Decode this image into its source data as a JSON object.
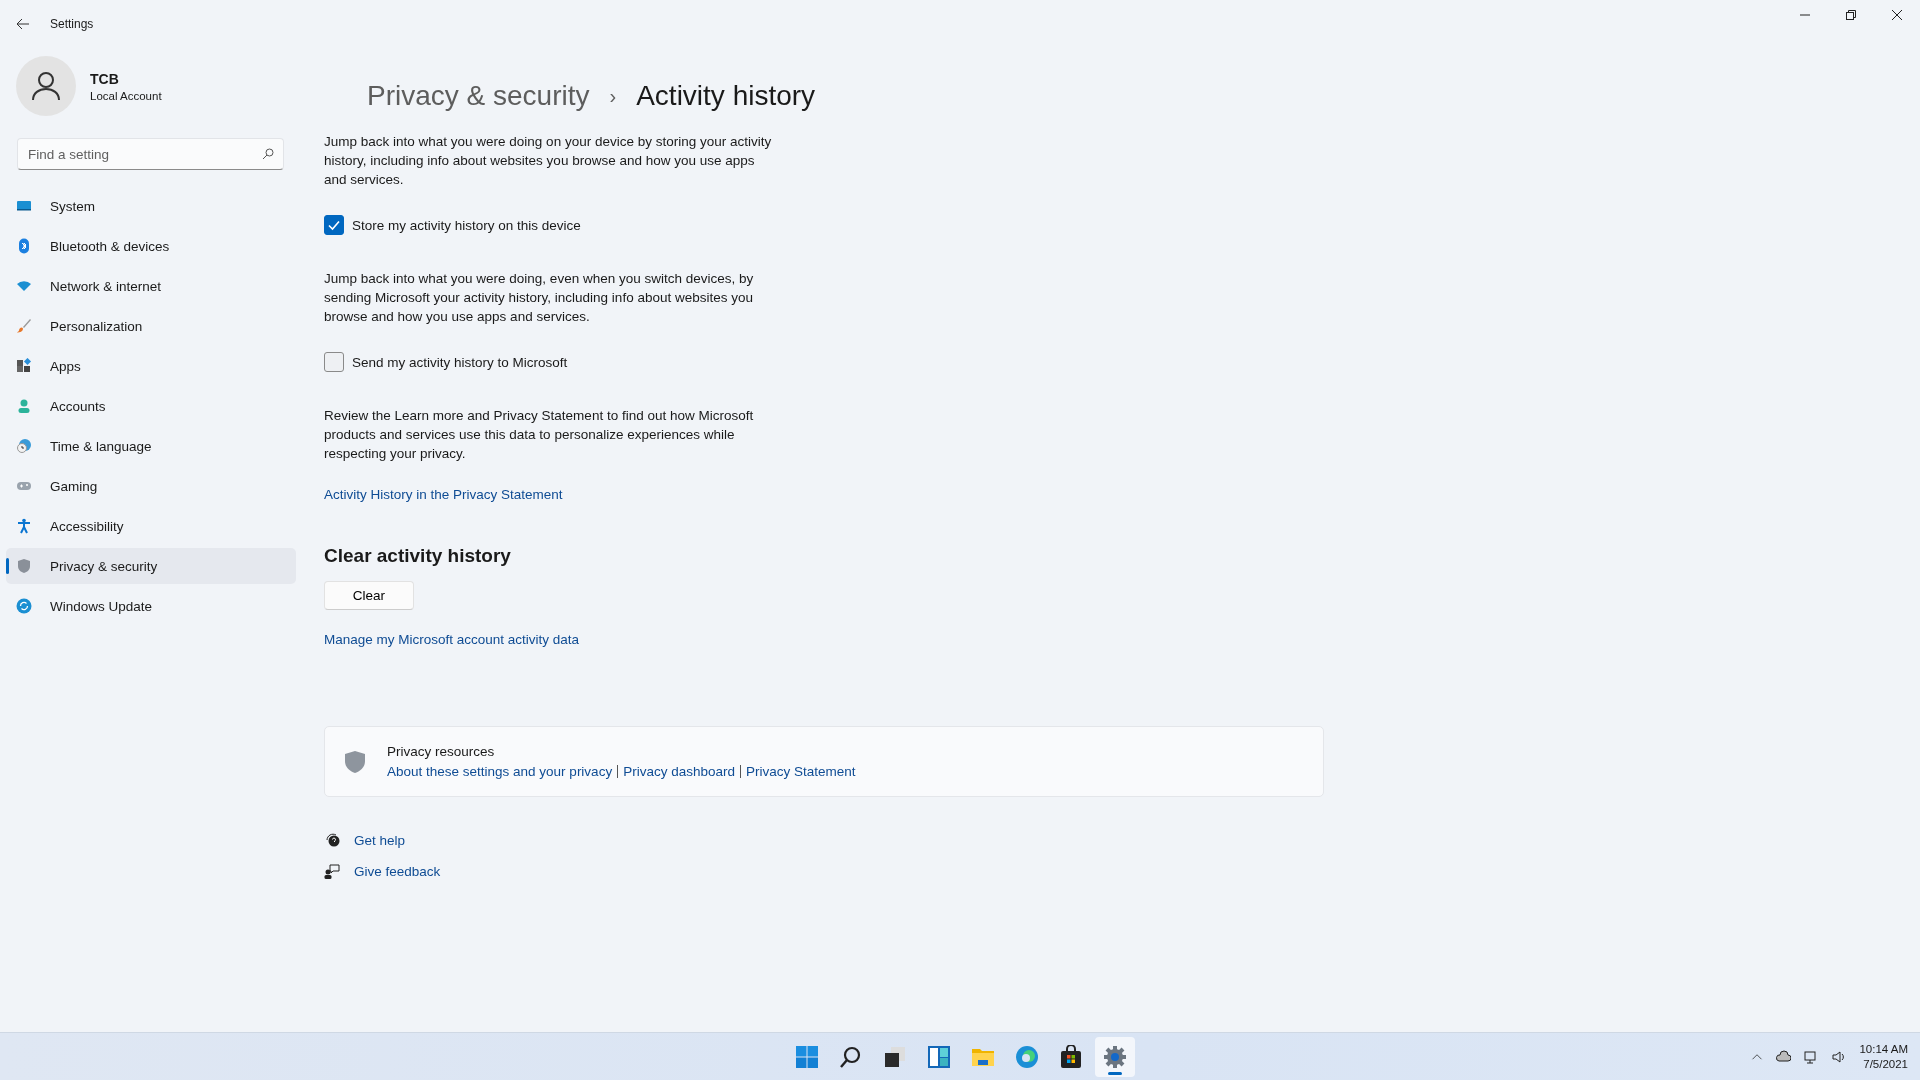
{
  "window": {
    "title": "Settings"
  },
  "account": {
    "name": "TCB",
    "type": "Local Account"
  },
  "search": {
    "placeholder": "Find a setting"
  },
  "nav": [
    {
      "label": "System",
      "selected": false
    },
    {
      "label": "Bluetooth & devices",
      "selected": false
    },
    {
      "label": "Network & internet",
      "selected": false
    },
    {
      "label": "Personalization",
      "selected": false
    },
    {
      "label": "Apps",
      "selected": false
    },
    {
      "label": "Accounts",
      "selected": false
    },
    {
      "label": "Time & language",
      "selected": false
    },
    {
      "label": "Gaming",
      "selected": false
    },
    {
      "label": "Accessibility",
      "selected": false
    },
    {
      "label": "Privacy & security",
      "selected": true
    },
    {
      "label": "Windows Update",
      "selected": false
    }
  ],
  "breadcrumb": {
    "parent": "Privacy & security",
    "separator": "›",
    "current": "Activity history"
  },
  "sections": [
    {
      "text": "Jump back into what you were doing on your device by storing your activity history, including info about websites you browse and how you use apps and services.",
      "checkbox": {
        "label": "Store my activity history on this device",
        "checked": true
      }
    },
    {
      "text": "Jump back into what you were doing, even when you switch devices, by sending Microsoft your activity history, including info about websites you browse and how you use apps and services.",
      "checkbox": {
        "label": "Send my activity history to Microsoft",
        "checked": false
      }
    }
  ],
  "review_text": "Review the Learn more and Privacy Statement to find out how Microsoft products and services use this data to personalize experiences while respecting your privacy.",
  "privacy_link": "Activity History in the Privacy Statement",
  "clear": {
    "heading": "Clear activity history",
    "button": "Clear",
    "link": "Manage my Microsoft account activity data"
  },
  "resources": {
    "title": "Privacy resources",
    "links": [
      "About these settings and your privacy",
      "Privacy dashboard",
      "Privacy Statement"
    ]
  },
  "help_links": [
    "Get help",
    "Give feedback"
  ],
  "taskbar": {
    "apps": [
      {
        "kind": "start",
        "selected": false
      },
      {
        "kind": "search",
        "selected": false
      },
      {
        "kind": "taskview",
        "selected": false
      },
      {
        "kind": "widgets",
        "selected": false
      },
      {
        "kind": "explorer",
        "selected": false
      },
      {
        "kind": "browser",
        "selected": false
      },
      {
        "kind": "store",
        "selected": false
      },
      {
        "kind": "settings",
        "selected": true
      }
    ],
    "time": "10:14 AM",
    "date": "7/5/2021"
  }
}
